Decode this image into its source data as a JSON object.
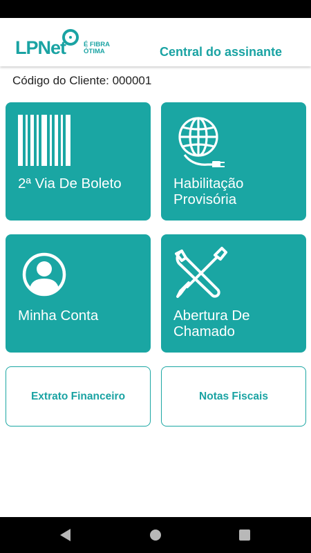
{
  "header": {
    "logo_text": "LPNet",
    "logo_tagline_1": "É FIBRA",
    "logo_tagline_2": "ÓTIMA",
    "title": "Central do assinante"
  },
  "client": {
    "code_label": "Código do Cliente: 000001"
  },
  "tiles": [
    {
      "label": "2ª Via De Boleto",
      "icon": "barcode-icon"
    },
    {
      "label": "Habilitação Provisória",
      "icon": "globe-plug-icon"
    },
    {
      "label": "Minha Conta",
      "icon": "user-account-icon"
    },
    {
      "label": "Abertura De Chamado",
      "icon": "tools-icon"
    }
  ],
  "buttons": {
    "statement": "Extrato Financeiro",
    "invoices": "Notas Fiscais"
  },
  "colors": {
    "accent": "#1aa6a3",
    "text_dark": "#222222",
    "system_bars": "#000000"
  },
  "navigation": {
    "back_icon": "back-triangle-icon",
    "home_icon": "home-circle-icon",
    "recents_icon": "recents-square-icon"
  }
}
